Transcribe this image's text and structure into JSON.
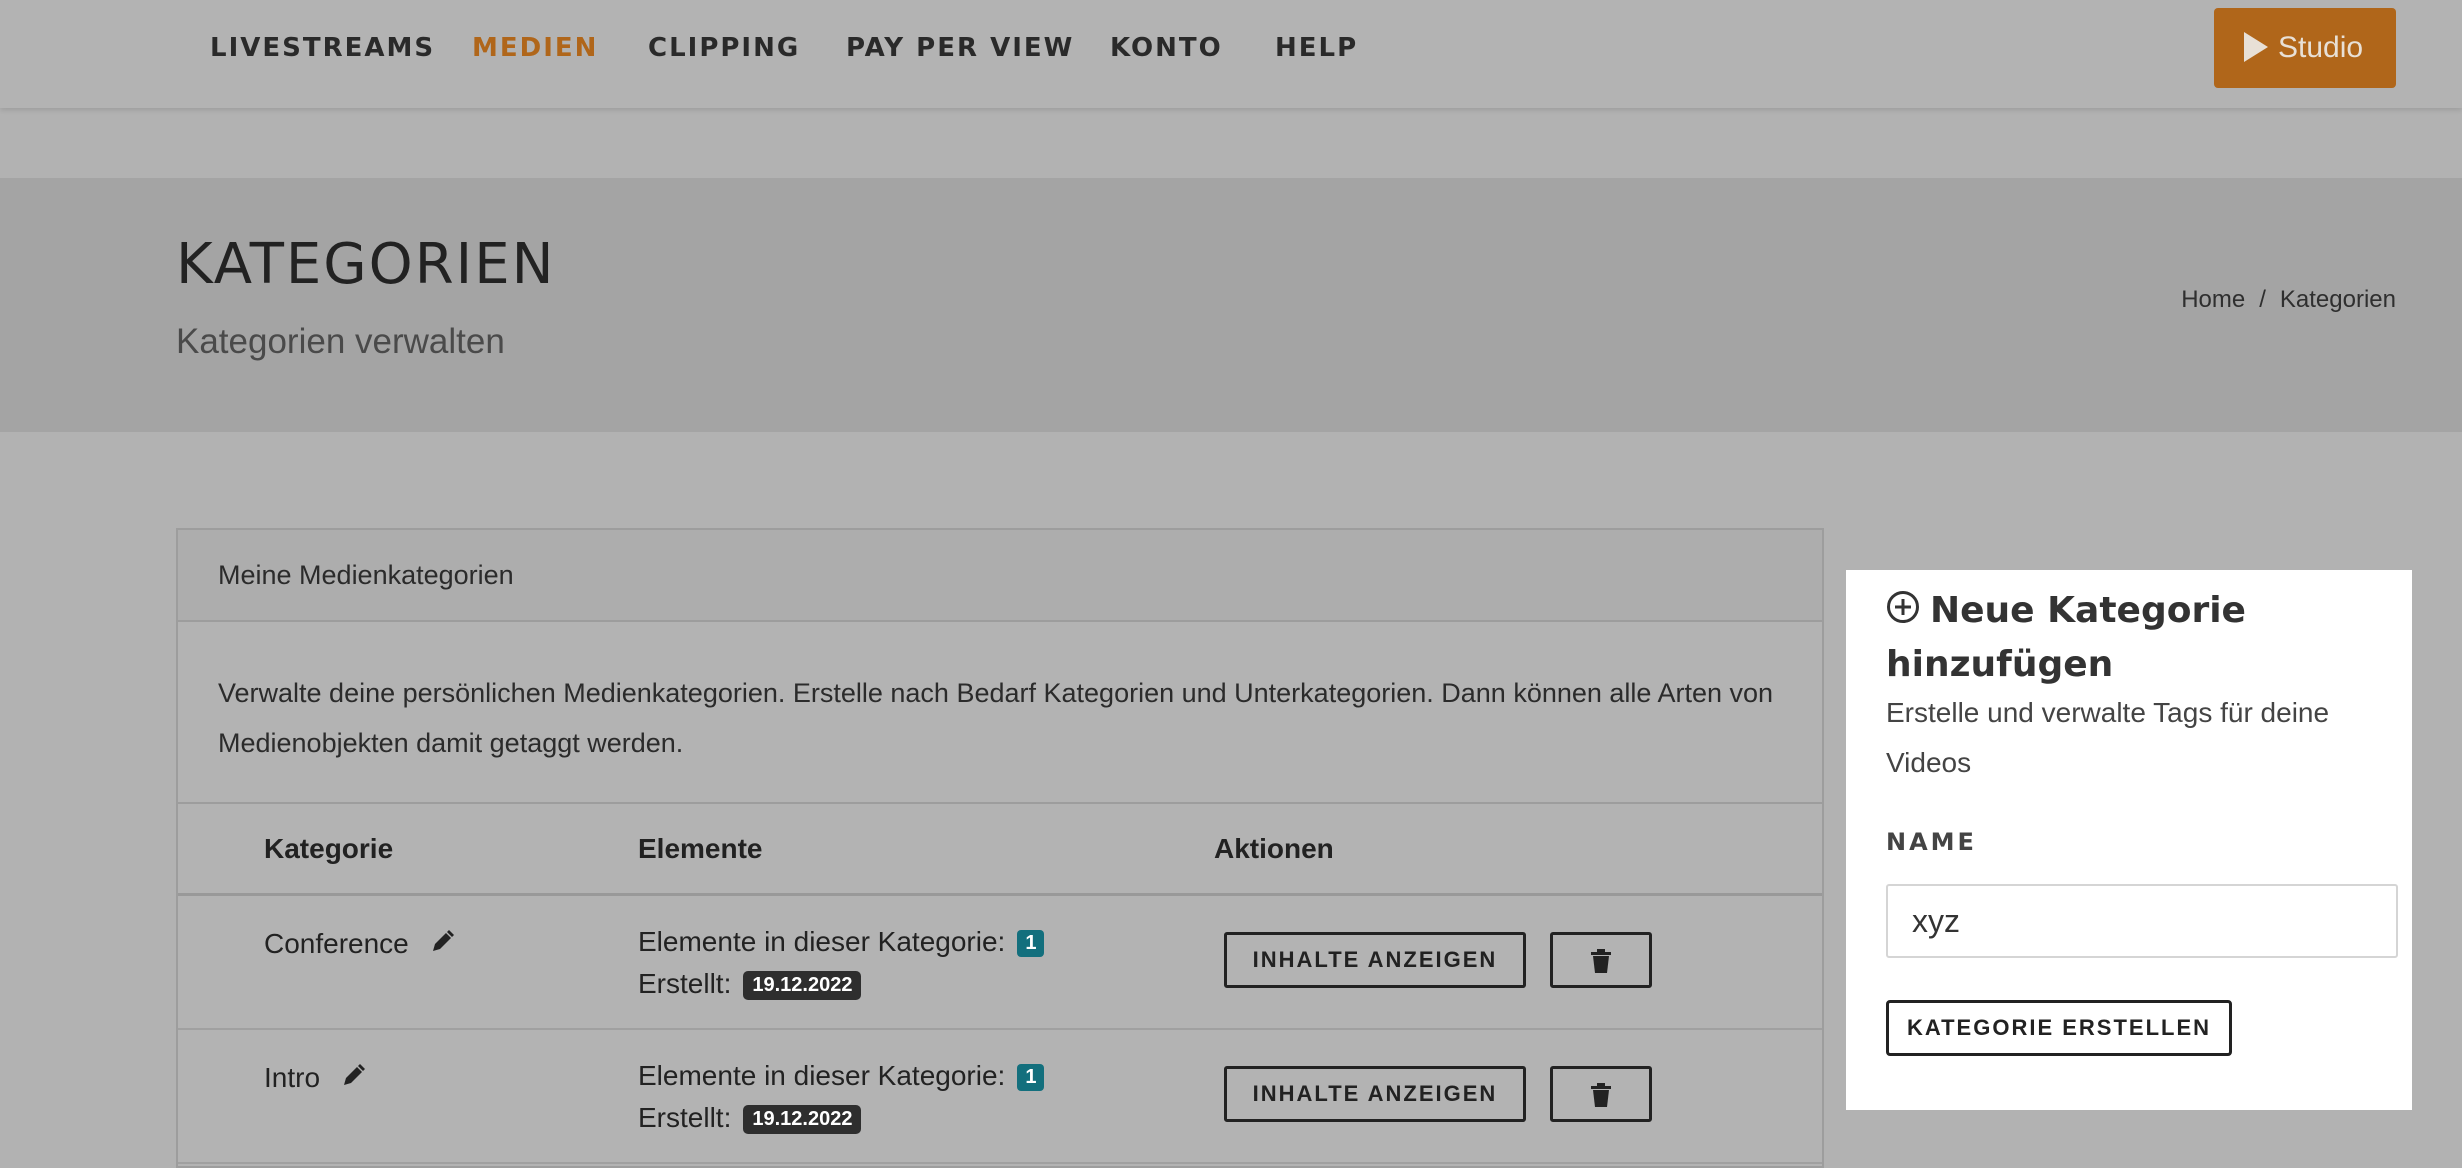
{
  "nav": {
    "items": [
      {
        "label": "LIVESTREAMS",
        "active": false
      },
      {
        "label": "MEDIEN",
        "active": true
      },
      {
        "label": "CLIPPING",
        "active": false
      },
      {
        "label": "PAY PER VIEW",
        "active": false
      },
      {
        "label": "KONTO",
        "active": false
      },
      {
        "label": "HELP",
        "active": false
      }
    ],
    "studio_label": "Studio",
    "accent_color": "#b0661a"
  },
  "page": {
    "title": "KATEGORIEN",
    "subtitle": "Kategorien verwalten",
    "breadcrumb": {
      "home": "Home",
      "separator": "/",
      "current": "Kategorien"
    }
  },
  "panel": {
    "header": "Meine Medienkategorien",
    "description": "Verwalte deine persönlichen Medienkategorien. Erstelle nach Bedarf Kategorien und Unterkategorien. Dann können alle Arten von Medienobjekten damit getaggt werden.",
    "columns": [
      "Kategorie",
      "Elemente",
      "Aktionen"
    ],
    "rows": [
      {
        "name": "Conference",
        "elements_label": "Elemente in dieser Kategorie:",
        "count": "1",
        "created_label": "Erstellt:",
        "created": "19.12.2022",
        "view_label": "INHALTE ANZEIGEN"
      },
      {
        "name": "Intro",
        "elements_label": "Elemente in dieser Kategorie:",
        "count": "1",
        "created_label": "Erstellt:",
        "created": "19.12.2022",
        "view_label": "INHALTE ANZEIGEN"
      }
    ]
  },
  "new_category": {
    "title": "Neue Kategorie hinzufügen",
    "description": "Erstelle und verwalte Tags für deine Videos",
    "field_label": "NAME",
    "name_value": "xyz",
    "submit_label": "KATEGORIE ERSTELLEN"
  }
}
